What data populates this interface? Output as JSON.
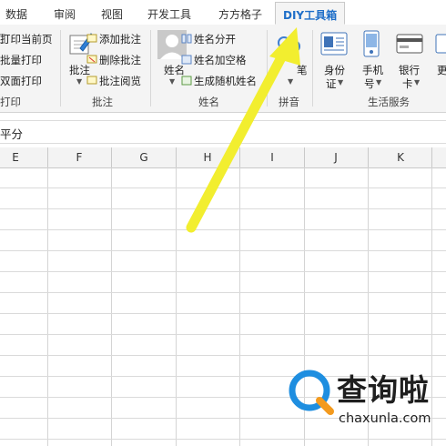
{
  "tabs": [
    {
      "label": "数据",
      "active": false
    },
    {
      "label": "审阅",
      "active": false
    },
    {
      "label": "视图",
      "active": false
    },
    {
      "label": "开发工具",
      "active": false
    },
    {
      "label": "方方格子",
      "active": false
    },
    {
      "label": "DIY工具箱",
      "active": true
    }
  ],
  "ribbon": {
    "print_group": {
      "items": [
        "打印当前页",
        "批量打印",
        "双面打印"
      ],
      "label": "打印"
    },
    "comment_group": {
      "big_button": "批注",
      "items": [
        "添加批注",
        "删除批注",
        "批注阅览"
      ],
      "label": "批注"
    },
    "name_group": {
      "big_button": "姓名",
      "items": [
        "姓名分开",
        "姓名加空格",
        "生成随机姓名"
      ],
      "label": "姓名"
    },
    "pinyin_group": {
      "big_button": "笔",
      "label": "拼音"
    },
    "life_group": {
      "buttons": [
        {
          "line1": "身份",
          "line2": "证"
        },
        {
          "line1": "手机",
          "line2": "号"
        },
        {
          "line1": "银行",
          "line2": "卡"
        },
        {
          "line1": "更",
          "line2": ""
        }
      ],
      "label": "生活服务"
    }
  },
  "formula_bar": {
    "text": "平分"
  },
  "columns": [
    "E",
    "F",
    "G",
    "H",
    "I",
    "J",
    "K"
  ],
  "watermark": {
    "title": "查询啦",
    "url": "chaxunla.com"
  },
  "colors": {
    "accent": "#1e6ec8",
    "arrow": "#f2ee2f",
    "logo_blue": "#1e8ee0",
    "logo_orange": "#f39a1e"
  }
}
